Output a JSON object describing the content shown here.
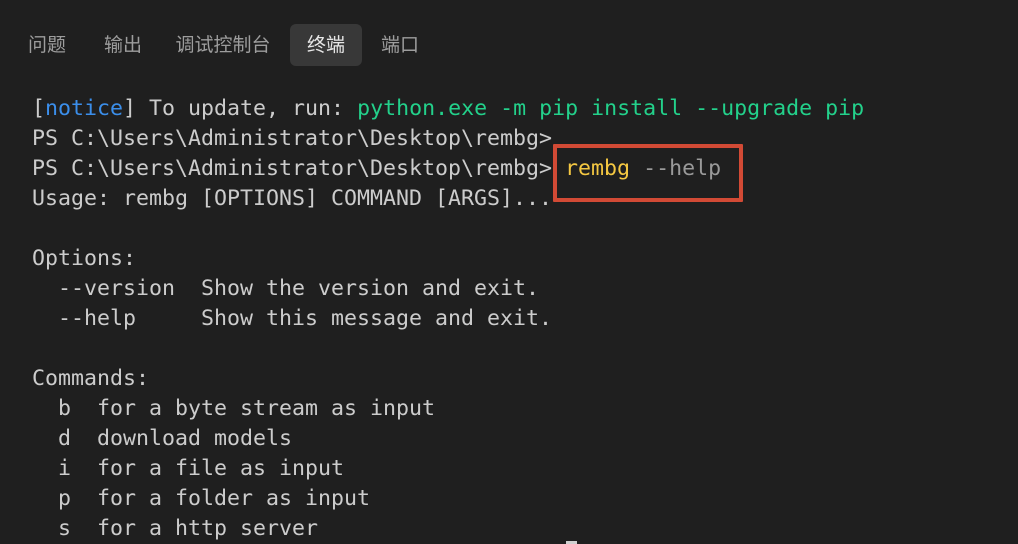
{
  "panel_tabs": [
    {
      "label": "问题",
      "active": false
    },
    {
      "label": "输出",
      "active": false
    },
    {
      "label": "调试控制台",
      "active": false
    },
    {
      "label": "终端",
      "active": true
    },
    {
      "label": "端口",
      "active": false
    }
  ],
  "terminal": {
    "notice_line": {
      "open_bracket": "[",
      "tag": "notice",
      "close_bracket": "]",
      "text": " To update, run: ",
      "command": "python.exe -m pip install --upgrade pip"
    },
    "prompt": "PS C:\\Users\\Administrator\\Desktop\\rembg>",
    "typed_command": {
      "program": "rembg",
      "args": "--help"
    },
    "usage": "Usage: rembg [OPTIONS] COMMAND [ARGS]...",
    "options_header": "Options:",
    "options": [
      {
        "flag": "--version",
        "description": "Show the version and exit."
      },
      {
        "flag": "--help",
        "description": "Show this message and exit."
      }
    ],
    "commands_header": "Commands:",
    "commands": [
      {
        "name": "b",
        "description": "for a byte stream as input"
      },
      {
        "name": "d",
        "description": "download models"
      },
      {
        "name": "i",
        "description": "for a file as input"
      },
      {
        "name": "p",
        "description": "for a folder as input"
      },
      {
        "name": "s",
        "description": "for a http server"
      }
    ]
  },
  "colors": {
    "background": "#1f1f1f",
    "notice": "#3b8eea",
    "suggested_command": "#23d18b",
    "typed_program": "#f5c842",
    "typed_args": "#9a9a9a",
    "highlight_border": "#d24a35"
  }
}
